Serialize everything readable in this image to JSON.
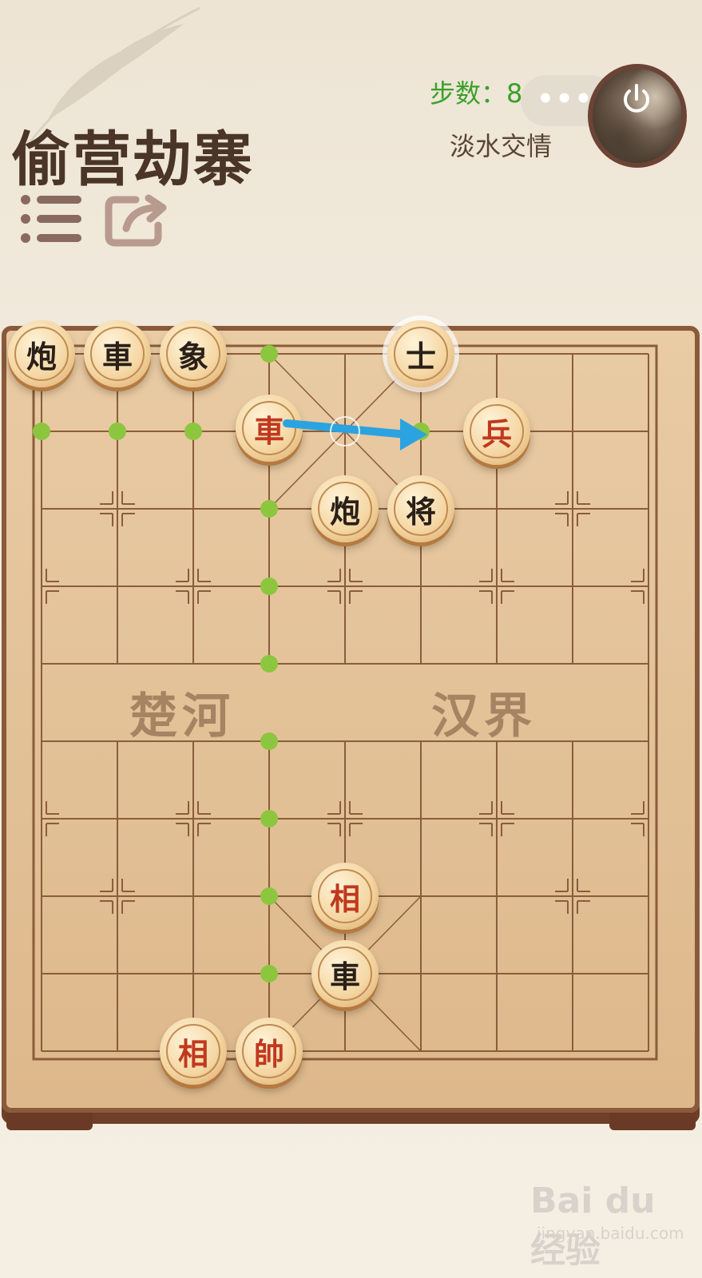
{
  "puzzle": {
    "title": "偷营劫寨"
  },
  "header": {
    "steps_label": "步数：8",
    "capsule_dots": "•••",
    "opponent_name": "淡水交情"
  },
  "board": {
    "river_left": "楚河",
    "river_right": "汉界",
    "pieces": [
      {
        "char": "炮",
        "side": "black",
        "file": 0,
        "rank": -1
      },
      {
        "char": "車",
        "side": "black",
        "file": 1,
        "rank": -1
      },
      {
        "char": "象",
        "side": "black",
        "file": 2,
        "rank": -1
      },
      {
        "char": "士",
        "side": "black",
        "file": 5,
        "rank": -1,
        "state": "selected"
      },
      {
        "char": "車",
        "side": "red",
        "file": 3,
        "rank": 0,
        "state": "lifted"
      },
      {
        "char": "兵",
        "side": "red",
        "file": 6,
        "rank": 0
      },
      {
        "char": "炮",
        "side": "black",
        "file": 4,
        "rank": 1
      },
      {
        "char": "将",
        "side": "black",
        "file": 5,
        "rank": 1
      },
      {
        "char": "相",
        "side": "red",
        "file": 4,
        "rank": 6
      },
      {
        "char": "車",
        "side": "black",
        "file": 4,
        "rank": 7
      },
      {
        "char": "相",
        "side": "red",
        "file": 2,
        "rank": 8
      },
      {
        "char": "帥",
        "side": "red",
        "file": 3,
        "rank": 8
      }
    ],
    "move_hints": [
      {
        "file": 3,
        "rank": -1
      },
      {
        "file": 0,
        "rank": 0
      },
      {
        "file": 1,
        "rank": 0
      },
      {
        "file": 2,
        "rank": 0
      },
      {
        "file": 5,
        "rank": 0
      },
      {
        "file": 3,
        "rank": 1
      },
      {
        "file": 3,
        "rank": 2
      },
      {
        "file": 3,
        "rank": 3
      },
      {
        "file": 3,
        "rank": 4
      },
      {
        "file": 3,
        "rank": 5
      },
      {
        "file": 3,
        "rank": 6
      },
      {
        "file": 3,
        "rank": 7
      }
    ],
    "arrow": {
      "from": {
        "file": 3,
        "rank": 0
      },
      "to": {
        "file": 5,
        "rank": 0
      },
      "color": "#2aa3e0"
    }
  },
  "watermark": {
    "brand": "Bai du 经验",
    "url": "jingyan.baidu.com"
  },
  "colors": {
    "steps": "#3aa02a",
    "title": "#4a3526",
    "hint": "#8cc63f",
    "red_piece": "#c0391e",
    "black_piece": "#2a2018"
  }
}
